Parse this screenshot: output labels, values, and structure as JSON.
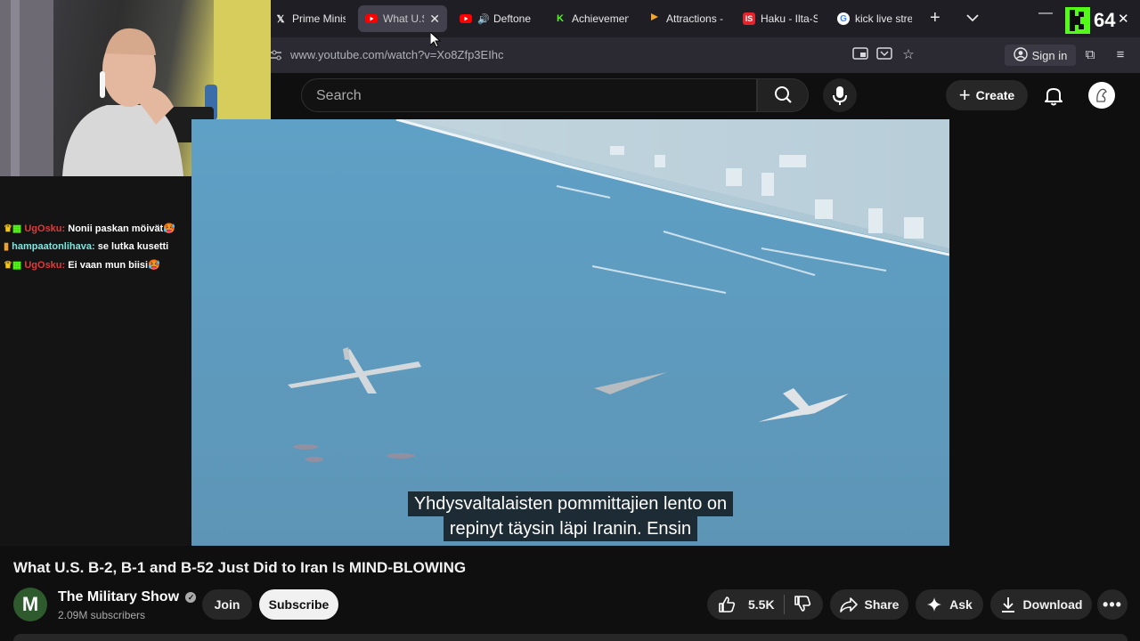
{
  "browser": {
    "tabs": [
      {
        "title": "Prime Minist",
        "favicon": "x-icon",
        "active": false
      },
      {
        "title": "What U.S",
        "favicon": "youtube-icon",
        "active": true
      },
      {
        "title": "Deftone",
        "favicon": "youtube-audio-icon",
        "active": false
      },
      {
        "title": "Achievement",
        "favicon": "kick-icon",
        "active": false
      },
      {
        "title": "Attractions -",
        "favicon": "flag-icon",
        "active": false
      },
      {
        "title": "Haku - Ilta-S",
        "favicon": "is-icon",
        "active": false
      },
      {
        "title": "kick live stre",
        "favicon": "google-icon",
        "active": false
      }
    ],
    "url": "www.youtube.com/watch?v=Xo8Zfp3EIhc",
    "sign_in": "Sign in"
  },
  "stream_overlay": {
    "kick_count": "64"
  },
  "chat": {
    "messages": [
      {
        "user": "UgOsku:",
        "text": "Nonii paskan möivät",
        "user_color": "#e03a3a"
      },
      {
        "user": "hampaatonlihava:",
        "text": "se lutka kusetti",
        "user_color": "#7ee6e0"
      },
      {
        "user": "UgOsku:",
        "text": "Ei vaan mun biisi",
        "user_color": "#e03a3a"
      }
    ]
  },
  "youtube": {
    "search_placeholder": "Search",
    "create_label": "Create",
    "subtitle_lines": [
      "Yhdysvaltalaisten pommittajien lento on",
      "repinyt täysin läpi Iranin.  Ensin"
    ],
    "video_title": "What U.S. B-2, B-1 and B-52 Just Did to Iran Is MIND-BLOWING",
    "channel": {
      "avatar_letter": "M",
      "name": "The Military Show",
      "subscribers": "2.09M subscribers"
    },
    "join_label": "Join",
    "subscribe_label": "Subscribe",
    "likes": "5.5K",
    "share_label": "Share",
    "ask_label": "Ask",
    "download_label": "Download"
  }
}
